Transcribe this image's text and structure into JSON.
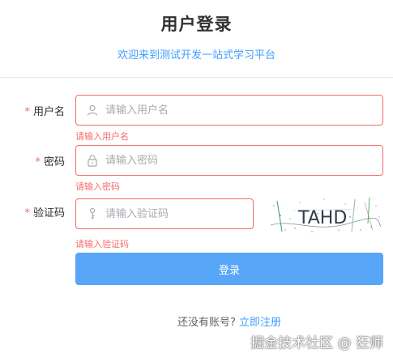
{
  "header": {
    "title": "用户登录",
    "subtitle": "欢迎来到测试开发一站式学习平台"
  },
  "form": {
    "required_mark": "*",
    "username": {
      "label": "用户名",
      "placeholder": "请输入用户名",
      "value": "",
      "error": "请输入用户名",
      "icon": "user-icon"
    },
    "password": {
      "label": "密码",
      "placeholder": "请输入密码",
      "value": "",
      "error": "请输入密码",
      "icon": "lock-icon"
    },
    "captcha": {
      "label": "验证码",
      "placeholder": "请输入验证码",
      "value": "",
      "error": "请输入验证码",
      "icon": "key-icon",
      "image_text": "TAHD"
    },
    "submit_label": "登录"
  },
  "footer": {
    "register_prompt": "还没有账号?",
    "register_link": "立即注册"
  },
  "watermark": "掘金技术社区 @ 狂师",
  "colors": {
    "accent": "#409eff",
    "button": "#58a6f8",
    "error": "#f56c6c"
  }
}
